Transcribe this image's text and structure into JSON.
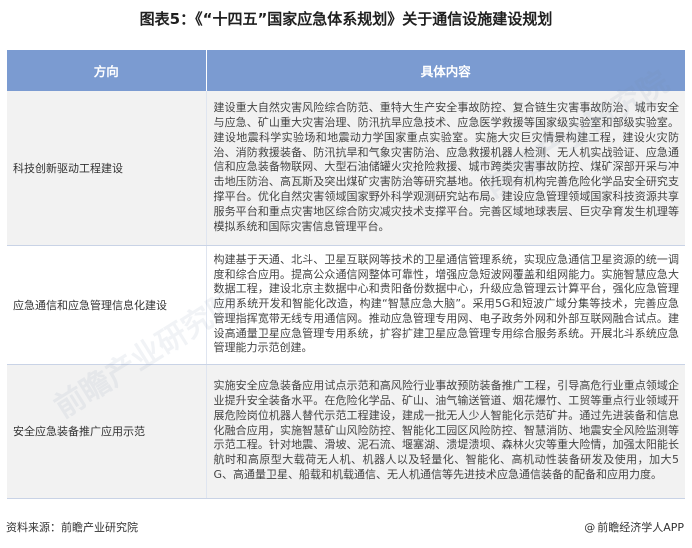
{
  "title": "图表5：《“十四五”国家应急体系规划》关于通信设施建设规划",
  "table": {
    "headers": [
      "方向",
      "具体内容"
    ],
    "rows": [
      {
        "direction": "科技创新驱动工程建设",
        "content": "建设重大自然灾害风险综合防范、重特大生产安全事故防控、复合链生灾害事故防治、城市安全与应急、矿山重大灾害治理、防汛抗旱应急技术、应急医学救援等国家级实验室和部级实验室。建设地震科学实验场和地震动力学国家重点实验室。实施大灾巨灾情景构建工程，建设火灾防治、消防救援装备、防汛抗旱和气象灾害防治、应急救援机器人检测、无人机实战验证、应急通信和应急装备物联网、大型石油储罐火灾抢险救援、城市跨类灾害事故防控、煤矿深部开采与冲击地压防治、高瓦斯及突出煤矿灾害防治等研究基地。依托现有机构完善危险化学品安全研究支撑平台。优化自然灾害领域国家野外科学观测研究站布局。建设应急管理领域国家科技资源共享服务平台和重点灾害地区综合防灾减灾技术支撑平台。完善区域地球表层、巨灾孕育发生机理等模拟系统和国际灾害信息管理平台。"
      },
      {
        "direction": "应急通信和应急管理信息化建设",
        "content": "构建基于天通、北斗、卫星互联网等技术的卫星通信管理系统，实现应急通信卫星资源的统一调度和综合应用。提高公众通信网整体可靠性，增强应急短波网覆盖和组网能力。实施智慧应急大数据工程，建设北京主数据中心和贵阳备份数据中心，升级应急管理云计算平台，强化应急管理应用系统开发和智能化改造，构建“智慧应急大脑”。采用5G和短波广域分集等技术，完善应急管理指挥宽带无线专用通信网。推动应急管理专用网、电子政务外网和外部互联网融合试点。建设高通量卫星应急管理专用系统，扩容扩建卫星应急管理专用综合服务系统。开展北斗系统应急管理能力示范创建。"
      },
      {
        "direction": "安全应急装备推广应用示范",
        "content": "实施安全应急装备应用试点示范和高风险行业事故预防装备推广工程，引导高危行业重点领域企业提升安全装备水平。在危险化学品、矿山、油气输送管道、烟花爆竹、工贸等重点行业领域开展危险岗位机器人替代示范工程建设，建成一批无人少人智能化示范矿井。通过先进装备和信息化融合应用，实施智慧矿山风险防控、智能化工园区风险防控、智慧消防、地震安全风险监测等示范工程。针对地震、滑坡、泥石流、堰塞湖、溃堤溃坝、森林火灾等重大险情，加强太阳能长航时和高原型大载荷无人机、机器人以及轻量化、智能化、高机动性装备研发及使用，加大5G、高通量卫星、船载和机载通信、无人机通信等先进技术应急通信装备的配备和应用力度。"
      }
    ]
  },
  "footer": {
    "source": "资料来源：前瞻产业研究院",
    "brand": "前瞻经济学人APP",
    "brand_icon": "at-sign-icon"
  },
  "watermark": {
    "text": "前瞻产业研究院"
  }
}
